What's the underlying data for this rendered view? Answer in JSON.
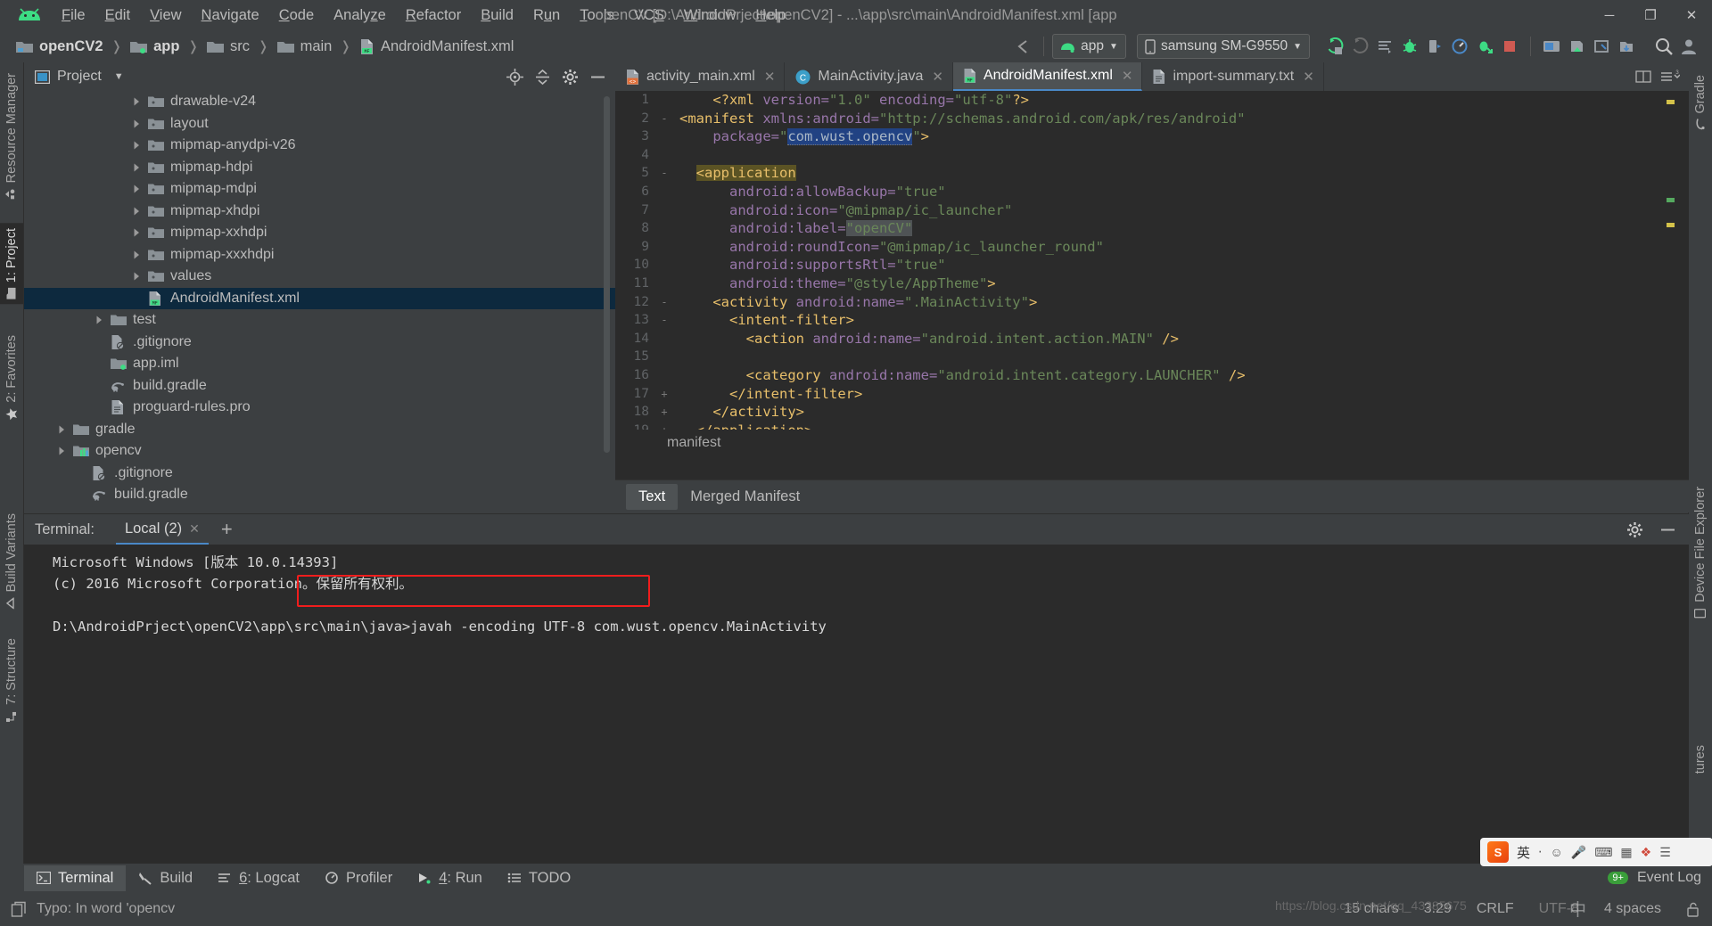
{
  "window": {
    "title": "openCV [D:\\AndroidPrject\\openCV2] - ...\\app\\src\\main\\AndroidManifest.xml [app",
    "minimize": "─",
    "maximize": "❐",
    "close": "✕"
  },
  "menubar": [
    {
      "label": "File"
    },
    {
      "label": "Edit"
    },
    {
      "label": "View"
    },
    {
      "label": "Navigate"
    },
    {
      "label": "Code"
    },
    {
      "label": "Analyze"
    },
    {
      "label": "Refactor"
    },
    {
      "label": "Build"
    },
    {
      "label": "Run"
    },
    {
      "label": "Tools"
    },
    {
      "label": "VCS"
    },
    {
      "label": "Window"
    },
    {
      "label": "Help"
    }
  ],
  "breadcrumbs": [
    {
      "label": "openCV2",
      "icon": "project-folder-icon"
    },
    {
      "label": "app",
      "icon": "module-folder-icon"
    },
    {
      "label": "src",
      "icon": "folder-icon"
    },
    {
      "label": "main",
      "icon": "folder-icon"
    },
    {
      "label": "AndroidManifest.xml",
      "icon": "manifest-file-icon"
    }
  ],
  "toolbar": {
    "run_config": "app",
    "device": "samsung SM-G9550",
    "icons": [
      "run-icon",
      "debug-attach-icon",
      "sync-gradle-icon",
      "debug-icon",
      "attach-debugger-icon",
      "profiler-icon",
      "run-coverage-icon",
      "stop-icon",
      "avd-manager-icon",
      "sdk-manager-icon",
      "layout-inspector-icon",
      "device-explorer-icon",
      "search-icon",
      "account-icon"
    ]
  },
  "left_stripe": {
    "top": [
      {
        "label": "Resource Manager",
        "icon": "resource-manager-icon"
      },
      {
        "label": "1: Project",
        "icon": "project-icon",
        "selected": true
      },
      {
        "label": "2: Favorites",
        "icon": "star-icon"
      }
    ],
    "bottom": [
      {
        "label": "Build Variants",
        "icon": "build-variants-icon"
      },
      {
        "label": "7: Structure",
        "icon": "structure-icon"
      }
    ]
  },
  "right_stripe": {
    "items": [
      {
        "label": "Gradle",
        "icon": "gradle-icon"
      },
      {
        "label": "Device File Explorer",
        "icon": "device-file-explorer-icon"
      },
      {
        "label": "tures",
        "icon": "captures-icon"
      }
    ]
  },
  "project_panel": {
    "title": "Project",
    "dropdown_icon": "chevron-down-icon",
    "actions": [
      "target-icon",
      "collapse-all-icon",
      "settings-gear-icon",
      "hide-icon"
    ],
    "tree": [
      {
        "label": "drawable-v24",
        "indent": 5,
        "arrow": true,
        "icon": "res-folder-icon"
      },
      {
        "label": "layout",
        "indent": 5,
        "arrow": true,
        "icon": "res-folder-icon"
      },
      {
        "label": "mipmap-anydpi-v26",
        "indent": 5,
        "arrow": true,
        "icon": "res-folder-icon"
      },
      {
        "label": "mipmap-hdpi",
        "indent": 5,
        "arrow": true,
        "icon": "res-folder-icon"
      },
      {
        "label": "mipmap-mdpi",
        "indent": 5,
        "arrow": true,
        "icon": "res-folder-icon"
      },
      {
        "label": "mipmap-xhdpi",
        "indent": 5,
        "arrow": true,
        "icon": "res-folder-icon"
      },
      {
        "label": "mipmap-xxhdpi",
        "indent": 5,
        "arrow": true,
        "icon": "res-folder-icon"
      },
      {
        "label": "mipmap-xxxhdpi",
        "indent": 5,
        "arrow": true,
        "icon": "res-folder-icon"
      },
      {
        "label": "values",
        "indent": 5,
        "arrow": true,
        "icon": "res-folder-icon"
      },
      {
        "label": "AndroidManifest.xml",
        "indent": 5,
        "arrow": false,
        "icon": "manifest-file-icon",
        "selected": true
      },
      {
        "label": "test",
        "indent": 3,
        "arrow": true,
        "icon": "folder-icon"
      },
      {
        "label": ".gitignore",
        "indent": 3,
        "arrow": false,
        "icon": "gitignore-file-icon"
      },
      {
        "label": "app.iml",
        "indent": 3,
        "arrow": false,
        "icon": "iml-file-icon"
      },
      {
        "label": "build.gradle",
        "indent": 3,
        "arrow": false,
        "icon": "gradle-file-icon"
      },
      {
        "label": "proguard-rules.pro",
        "indent": 3,
        "arrow": false,
        "icon": "text-file-icon"
      },
      {
        "label": "gradle",
        "indent": 1,
        "arrow": true,
        "icon": "folder-icon"
      },
      {
        "label": "opencv",
        "indent": 1,
        "arrow": true,
        "icon": "library-module-icon"
      },
      {
        "label": ".gitignore",
        "indent": 2,
        "arrow": false,
        "icon": "gitignore-file-icon"
      },
      {
        "label": "build.gradle",
        "indent": 2,
        "arrow": false,
        "icon": "gradle-file-icon"
      }
    ]
  },
  "editor": {
    "tabs": [
      {
        "label": "activity_main.xml",
        "icon": "layout-xml-icon",
        "active": false,
        "closable": true
      },
      {
        "label": "MainActivity.java",
        "icon": "java-class-icon",
        "active": false,
        "closable": true
      },
      {
        "label": "AndroidManifest.xml",
        "icon": "manifest-file-icon",
        "active": true,
        "closable": true
      },
      {
        "label": "import-summary.txt",
        "icon": "text-file-icon",
        "active": false,
        "closable": true
      }
    ],
    "tab_actions": [
      "split-icon",
      "tab-list-icon"
    ],
    "breadcrumb": "manifest",
    "bottom_tabs": [
      {
        "label": "Text",
        "selected": true
      },
      {
        "label": "Merged Manifest",
        "selected": false
      }
    ],
    "lines": [
      {
        "n": "1",
        "fold": "",
        "segments": [
          {
            "t": "    ",
            "c": "plain"
          },
          {
            "t": "<?xml",
            "c": "tag"
          },
          {
            "t": " version=",
            "c": "attr"
          },
          {
            "t": "\"1.0\"",
            "c": "str"
          },
          {
            "t": " encoding=",
            "c": "attr"
          },
          {
            "t": "\"utf-8\"",
            "c": "str"
          },
          {
            "t": "?>",
            "c": "tag"
          }
        ]
      },
      {
        "n": "2",
        "fold": "-",
        "segments": [
          {
            "t": "<manifest",
            "c": "tag"
          },
          {
            "t": " xmlns:android=",
            "c": "attr"
          },
          {
            "t": "\"http://schemas.android.com/apk/res/android\"",
            "c": "str"
          }
        ]
      },
      {
        "n": "3",
        "fold": "",
        "segments": [
          {
            "t": "    package=",
            "c": "attr"
          },
          {
            "t": "\"",
            "c": "str"
          },
          {
            "t": "com.wust.opencv",
            "c": "hl-pkg"
          },
          {
            "t": "\"",
            "c": "str"
          },
          {
            "t": ">",
            "c": "tag"
          }
        ]
      },
      {
        "n": "4",
        "fold": "",
        "segments": []
      },
      {
        "n": "5",
        "fold": "-",
        "segments": [
          {
            "t": "  ",
            "c": "plain"
          },
          {
            "t": "<application",
            "c": "hl-app"
          }
        ]
      },
      {
        "n": "6",
        "fold": "",
        "segments": [
          {
            "t": "      android:allowBackup=",
            "c": "attr"
          },
          {
            "t": "\"true\"",
            "c": "str"
          }
        ]
      },
      {
        "n": "7",
        "fold": "",
        "segments": [
          {
            "t": "      android:icon=",
            "c": "attr"
          },
          {
            "t": "\"@mipmap/ic_launcher\"",
            "c": "str"
          }
        ]
      },
      {
        "n": "8",
        "fold": "",
        "segments": [
          {
            "t": "      android:label=",
            "c": "attr"
          },
          {
            "t": "\"openCV\"",
            "c": "hl-lbl"
          }
        ]
      },
      {
        "n": "9",
        "fold": "",
        "segments": [
          {
            "t": "      android:roundIcon=",
            "c": "attr"
          },
          {
            "t": "\"@mipmap/ic_launcher_round\"",
            "c": "str"
          }
        ]
      },
      {
        "n": "10",
        "fold": "",
        "segments": [
          {
            "t": "      android:supportsRtl=",
            "c": "attr"
          },
          {
            "t": "\"true\"",
            "c": "str"
          }
        ]
      },
      {
        "n": "11",
        "fold": "",
        "segments": [
          {
            "t": "      android:theme=",
            "c": "attr"
          },
          {
            "t": "\"@style/AppTheme\"",
            "c": "str"
          },
          {
            "t": ">",
            "c": "tag"
          }
        ]
      },
      {
        "n": "12",
        "fold": "-",
        "segments": [
          {
            "t": "    ",
            "c": "plain"
          },
          {
            "t": "<activity",
            "c": "tag"
          },
          {
            "t": " android:name=",
            "c": "attr"
          },
          {
            "t": "\".MainActivity\"",
            "c": "str"
          },
          {
            "t": ">",
            "c": "tag"
          }
        ]
      },
      {
        "n": "13",
        "fold": "-",
        "segments": [
          {
            "t": "      ",
            "c": "plain"
          },
          {
            "t": "<intent-filter>",
            "c": "tag"
          }
        ]
      },
      {
        "n": "14",
        "fold": "",
        "segments": [
          {
            "t": "        ",
            "c": "plain"
          },
          {
            "t": "<action",
            "c": "tag"
          },
          {
            "t": " android:name=",
            "c": "attr"
          },
          {
            "t": "\"android.intent.action.MAIN\"",
            "c": "str"
          },
          {
            "t": " />",
            "c": "tag"
          }
        ]
      },
      {
        "n": "15",
        "fold": "",
        "segments": []
      },
      {
        "n": "16",
        "fold": "",
        "segments": [
          {
            "t": "        ",
            "c": "plain"
          },
          {
            "t": "<category",
            "c": "tag"
          },
          {
            "t": " android:name=",
            "c": "attr"
          },
          {
            "t": "\"android.intent.category.LAUNCHER\"",
            "c": "str"
          },
          {
            "t": " />",
            "c": "tag"
          }
        ]
      },
      {
        "n": "17",
        "fold": "+",
        "segments": [
          {
            "t": "      ",
            "c": "plain"
          },
          {
            "t": "</intent-filter>",
            "c": "tag"
          }
        ]
      },
      {
        "n": "18",
        "fold": "+",
        "segments": [
          {
            "t": "    ",
            "c": "plain"
          },
          {
            "t": "</activity>",
            "c": "tag"
          }
        ]
      },
      {
        "n": "19",
        "fold": "+",
        "segments": [
          {
            "t": "  ",
            "c": "plain"
          },
          {
            "t": "</application>",
            "c": "tag"
          }
        ]
      }
    ]
  },
  "terminal": {
    "label": "Terminal:",
    "tab": "Local (2)",
    "tab_close": "✕",
    "add": "+",
    "actions": [
      "settings-gear-icon",
      "hide-icon"
    ],
    "lines": [
      "Microsoft Windows [版本 10.0.14393]",
      "(c) 2016 Microsoft Corporation。保留所有权利。",
      "",
      ""
    ],
    "prompt": "D:\\AndroidPrject\\openCV2\\app\\src\\main\\java>",
    "command": "javah -encoding UTF-8 com.wust.opencv.MainActivity",
    "highlight_color": "#f01d1d"
  },
  "bottom_toolbar": [
    {
      "label": "Terminal",
      "icon": "terminal-icon",
      "selected": true
    },
    {
      "label": "Build",
      "icon": "build-hammer-icon",
      "selected": false
    },
    {
      "label": "6: Logcat",
      "icon": "logcat-icon",
      "selected": false
    },
    {
      "label": "Profiler",
      "icon": "profiler-icon",
      "selected": false
    },
    {
      "label": "4: Run",
      "icon": "run-icon",
      "selected": false
    },
    {
      "label": "TODO",
      "icon": "todo-icon",
      "selected": false
    }
  ],
  "status_bar": {
    "message": "Typo: In word 'opencv",
    "message_icon": "copy-icon",
    "chars": "15 chars",
    "caret": "3:29",
    "line_separator": "CRLF",
    "encoding": "UTF-8",
    "indent": "4 spaces",
    "lock_icon": "unlocked-icon",
    "event_log": "Event Log",
    "event_badge": "9+"
  },
  "ime": {
    "lang": "英",
    "logo": "S",
    "icons": [
      "dot-icon",
      "smiley-icon",
      "mic-icon",
      "keyboard-icon",
      "image-icon",
      "gift-icon",
      "menu-icon"
    ]
  },
  "watermark": {
    "url": "https://blog.csdn.net/qq_43385675",
    "extra": "中"
  }
}
